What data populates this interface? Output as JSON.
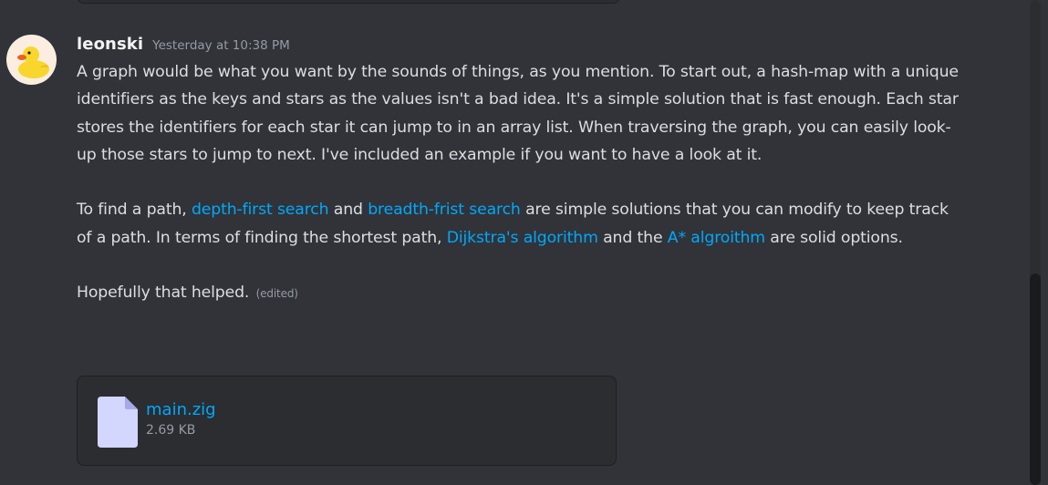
{
  "message": {
    "author": "leonski",
    "timestamp": "Yesterday at 10:38 PM",
    "paragraph1": "A graph would be what you want by the sounds of things, as you mention. To start out, a hash-map with a unique identifiers as the keys and stars as the values isn't a bad idea. It's a simple solution that is fast enough. Each star stores the identifiers for each star it can jump to in an array list. When traversing the graph, you can easily look-up those stars to jump to next. I've included an example if you want to have a look at it.",
    "paragraph2": {
      "t1": "To find a path, ",
      "link1": "depth-first search",
      "t2": " and ",
      "link2": "breadth-frist search",
      "t3": " are simple solutions that you can modify to keep track of a path. In terms of finding the shortest path, ",
      "link3": "Dijkstra's algorithm",
      "t4": " and the ",
      "link4": "A* algroithm",
      "t5": " are solid options."
    },
    "paragraph3": "Hopefully that helped.",
    "edited_label": "(edited)"
  },
  "attachment": {
    "name": "main.zig",
    "size": "2.69 KB",
    "icon": "file-icon"
  },
  "avatar": {
    "icon": "rubber-duck-avatar",
    "background": "#fbeee0",
    "duck_color": "#f9d62e"
  },
  "colors": {
    "background": "#313338",
    "link": "#00a8fc",
    "text": "#dbdee1",
    "muted": "#949ba4"
  }
}
